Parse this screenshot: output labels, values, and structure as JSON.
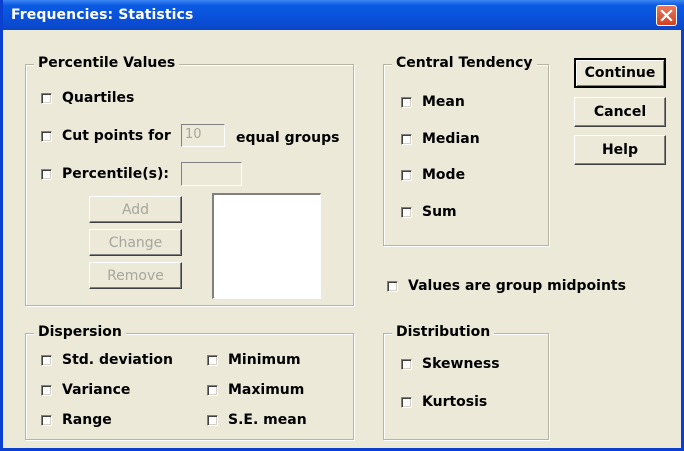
{
  "window": {
    "title": "Frequencies: Statistics"
  },
  "percentile_values": {
    "legend": "Percentile Values",
    "quartiles": "Quartiles",
    "cut_points": "Cut points for",
    "cut_points_value": "10",
    "equal_groups": "equal groups",
    "percentiles": "Percentile(s):",
    "percentile_value": "",
    "add": "Add",
    "change": "Change",
    "remove": "Remove"
  },
  "central_tendency": {
    "legend": "Central Tendency",
    "mean": "Mean",
    "median": "Median",
    "mode": "Mode",
    "sum": "Sum"
  },
  "buttons": {
    "continue": "Continue",
    "cancel": "Cancel",
    "help": "Help"
  },
  "group_midpoints": "Values are group midpoints",
  "dispersion": {
    "legend": "Dispersion",
    "std_deviation": "Std. deviation",
    "variance": "Variance",
    "range": "Range",
    "minimum": "Minimum",
    "maximum": "Maximum",
    "se_mean": "S.E. mean"
  },
  "distribution": {
    "legend": "Distribution",
    "skewness": "Skewness",
    "kurtosis": "Kurtosis"
  }
}
